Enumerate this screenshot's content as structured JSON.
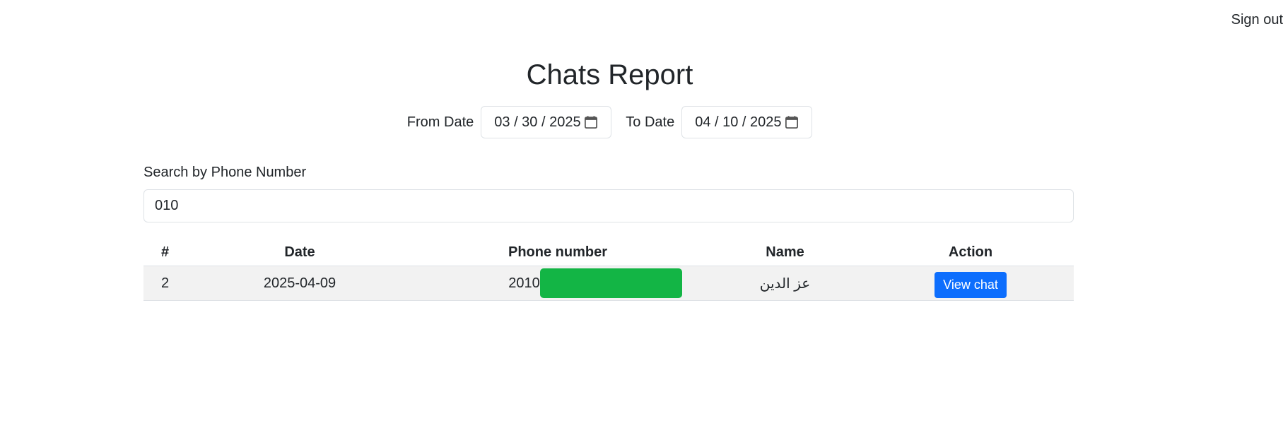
{
  "header": {
    "signout_label": "Sign out"
  },
  "page": {
    "title": "Chats Report"
  },
  "filters": {
    "from_label": "From Date",
    "from_value": "03 / 30 / 2025",
    "to_label": "To Date",
    "to_value": "04 / 10 / 2025",
    "calendar_icon": "calendar-icon"
  },
  "search": {
    "label": "Search by Phone Number",
    "value": "010"
  },
  "table": {
    "headers": [
      "#",
      "Date",
      "Phone number",
      "Name",
      "Action"
    ],
    "rows": [
      {
        "num": "2",
        "date": "2025-04-09",
        "phone_visible": "2010",
        "name": "عز الدين",
        "action_label": "View chat"
      }
    ]
  },
  "colors": {
    "accent": "#0d6efd",
    "redaction": "#13b545",
    "row_background": "#f2f2f2"
  }
}
